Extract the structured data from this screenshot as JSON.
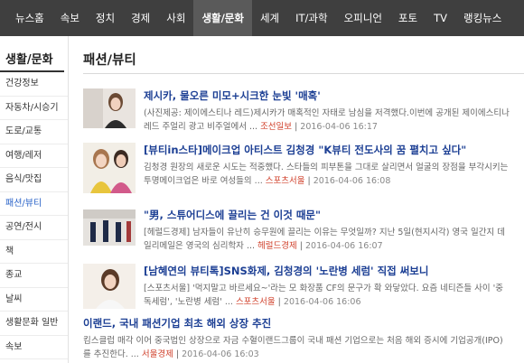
{
  "nav": {
    "items": [
      {
        "label": "뉴스홈",
        "active": false
      },
      {
        "label": "속보",
        "active": false
      },
      {
        "label": "정치",
        "active": false
      },
      {
        "label": "경제",
        "active": false
      },
      {
        "label": "사회",
        "active": false
      },
      {
        "label": "생활/문화",
        "active": true
      },
      {
        "label": "세계",
        "active": false
      },
      {
        "label": "IT/과학",
        "active": false
      },
      {
        "label": "오피니언",
        "active": false
      },
      {
        "label": "포토",
        "active": false
      },
      {
        "label": "TV",
        "active": false
      },
      {
        "label": "랭킹뉴스",
        "active": false
      }
    ]
  },
  "sidebar": {
    "heading": "생활/문화",
    "items": [
      {
        "label": "건강정보",
        "active": false
      },
      {
        "label": "자동차/시승기",
        "active": false
      },
      {
        "label": "도로/교통",
        "active": false
      },
      {
        "label": "여행/레저",
        "active": false
      },
      {
        "label": "음식/맛집",
        "active": false
      },
      {
        "label": "패션/뷰티",
        "active": true
      },
      {
        "label": "공연/전시",
        "active": false
      },
      {
        "label": "책",
        "active": false
      },
      {
        "label": "종교",
        "active": false
      },
      {
        "label": "날씨",
        "active": false
      },
      {
        "label": "생활문화 일반",
        "active": false
      },
      {
        "label": "속보",
        "active": false
      }
    ]
  },
  "main": {
    "title": "패션/뷰티",
    "articles": [
      {
        "headline": "제시카, 물오른 미모+시크한 눈빛 '매혹'",
        "snippet": "(사진제공: 제이에스티나 레드)제시카가 매혹적인 자태로 남심을 저격했다.이번에 공개된 제이에스티나 레드 주얼리 광고 비주얼에서 ...",
        "source": "조선일보",
        "date": "2016-04-06 16:17"
      },
      {
        "headline": "[뷰티in스타]메이크업 아티스트 김청경 \"K뷰티 전도사의 꿈 펼치고 싶다\"",
        "snippet": "김청경 원장의 새로운 시도는 적중했다. 스타들의 피부톤을 그대로 살리면서 얼굴의 장점을 부각시키는 투명메이크업은 바로 여성들의 ...",
        "source": "스포츠서울",
        "date": "2016-04-06 16:08"
      },
      {
        "headline": "\"男, 스튜어디스에 끌리는 건 이것 때문\"",
        "snippet": "[헤럴드경제] 남자들이 유난히 승무원에 끌리는 이유는 무엇일까? 지난 5일(현지시각) 영국 일간지 데일리메일은 영국의 심리학자 ...",
        "source": "헤럴드경제",
        "date": "2016-04-06 16:07"
      },
      {
        "headline": "[남혜연의 뷰티톡]SNS화제, 김청경의 '노란병 세럼' 직접 써보니",
        "snippet": "[스포츠서울] '먹지말고 바르세요~'라는 모 화장품 CF의 문구가 확 와닿았다. 요즘 네티즌들 사이 '중독세럼', '노란병 세럼' ...",
        "source": "스포츠서울",
        "date": "2016-04-06 16:06"
      },
      {
        "headline": "이랜드, 국내 패션기업 최초 해외 상장 추진",
        "snippet": "킴스클럽 매각 이어 중국법인 상장으로 자금 수혈이랜드그룹이 국내 패션 기업으로는 처음 해외 증시에 기업공개(IPO)를 추진한다. ...",
        "source": "서울경제",
        "date": "2016-04-06 16:03"
      }
    ]
  }
}
